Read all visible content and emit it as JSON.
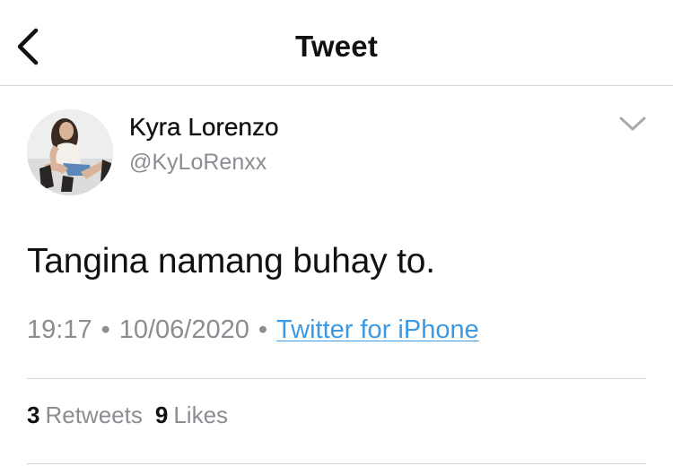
{
  "header": {
    "title": "Tweet",
    "back_icon": "chevron-left-icon"
  },
  "tweet": {
    "author": {
      "name": "Kyra Lorenzo",
      "handle": "@KyLoRenxx",
      "avatar": "profile-photo"
    },
    "more_icon": "chevron-down-icon",
    "text": "Tangina namang buhay to.",
    "time": "19:17",
    "date": "10/06/2020",
    "separator": "•",
    "source": "Twitter for iPhone"
  },
  "stats": {
    "retweets_count": "3",
    "retweets_label": "Retweets",
    "likes_count": "9",
    "likes_label": "Likes"
  },
  "colors": {
    "link": "#3d99e1",
    "muted": "#8a8d91",
    "divider": "#d6d6d6",
    "text": "#111111"
  }
}
